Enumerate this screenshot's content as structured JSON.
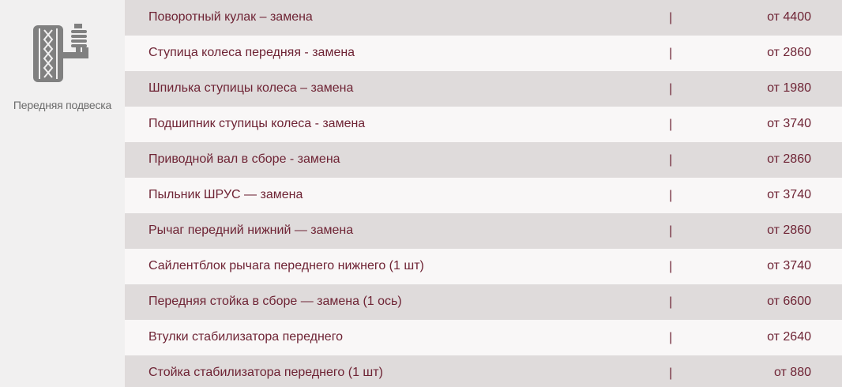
{
  "sidebar": {
    "icon": "suspension-icon",
    "label": "Передняя подвеска"
  },
  "services": [
    {
      "name": "Поворотный кулак – замена",
      "separator": "|",
      "price": "от 4400"
    },
    {
      "name": "Ступица колеса передняя - замена",
      "separator": "|",
      "price": "от 2860"
    },
    {
      "name": "Шпилька ступицы колеса – замена",
      "separator": "|",
      "price": "от 1980"
    },
    {
      "name": "Подшипник ступицы колеса - замена",
      "separator": "|",
      "price": "от 3740"
    },
    {
      "name": "Приводной вал в сборе - замена",
      "separator": "|",
      "price": "от 2860"
    },
    {
      "name": "Пыльник ШРУС — замена",
      "separator": "|",
      "price": "от 3740"
    },
    {
      "name": "Рычаг передний нижний — замена",
      "separator": "|",
      "price": "от 2860"
    },
    {
      "name": "Сайлентблок рычага переднего нижнего (1 шт)",
      "separator": "|",
      "price": "от 3740"
    },
    {
      "name": "Передняя стойка в сборе — замена (1 ось)",
      "separator": "|",
      "price": "от 6600"
    },
    {
      "name": "Втулки стабилизатора переднего",
      "separator": "|",
      "price": "от 2640"
    },
    {
      "name": "Стойка стабилизатора переднего (1 шт)",
      "separator": "|",
      "price": "от 880"
    }
  ],
  "colors": {
    "text": "#6e2334",
    "row_dark": "#dfdbdb",
    "row_light": "#f9f7f7",
    "sidebar_bg": "#f1f0f0",
    "icon": "#808080"
  }
}
